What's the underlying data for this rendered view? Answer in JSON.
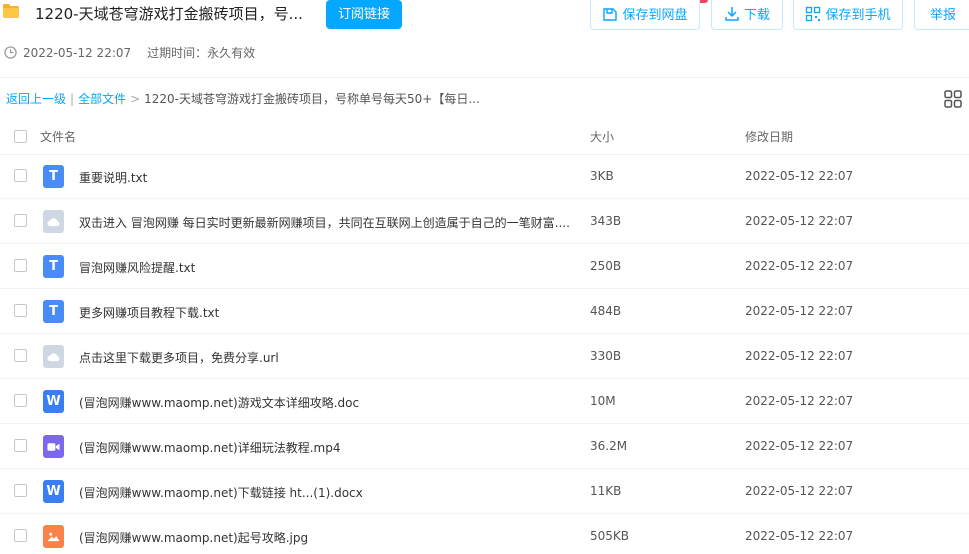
{
  "header": {
    "title": "1220-天域苍穹游戏打金搬砖项目，号...",
    "subscribe_label": "订阅链接",
    "save_disk_label": "保存到网盘",
    "download_label": "下载",
    "save_phone_label": "保存到手机",
    "report_label": "举报",
    "created": "2022-05-12 22:07",
    "expire": "过期时间：永久有效"
  },
  "breadcrumb": {
    "back": "返回上一级",
    "sep": "|",
    "all": "全部文件",
    "arrow": ">",
    "current": "1220-天域苍穹游戏打金搬砖项目，号称单号每天50+【每日..."
  },
  "columns": {
    "name": "文件名",
    "size": "大小",
    "date": "修改日期"
  },
  "files": [
    {
      "name": "重要说明.txt",
      "size": "3KB",
      "date": "2022-05-12 22:07",
      "type": "txt",
      "glyph": "T"
    },
    {
      "name": "双击进入 冒泡网赚 每日实时更新最新网赚项目，共同在互联网上创造属于自己的一笔财富....",
      "size": "343B",
      "date": "2022-05-12 22:07",
      "type": "url",
      "glyph": ""
    },
    {
      "name": "冒泡网赚风险提醒.txt",
      "size": "250B",
      "date": "2022-05-12 22:07",
      "type": "txt",
      "glyph": "T"
    },
    {
      "name": "更多网赚项目教程下载.txt",
      "size": "484B",
      "date": "2022-05-12 22:07",
      "type": "txt",
      "glyph": "T"
    },
    {
      "name": "点击这里下载更多项目，免费分享.url",
      "size": "330B",
      "date": "2022-05-12 22:07",
      "type": "url",
      "glyph": ""
    },
    {
      "name": "(冒泡网赚www.maomp.net)游戏文本详细攻略.doc",
      "size": "10M",
      "date": "2022-05-12 22:07",
      "type": "doc",
      "glyph": "W"
    },
    {
      "name": "(冒泡网赚www.maomp.net)详细玩法教程.mp4",
      "size": "36.2M",
      "date": "2022-05-12 22:07",
      "type": "mp4",
      "glyph": ""
    },
    {
      "name": "(冒泡网赚www.maomp.net)下载链接 ht...(1).docx",
      "size": "11KB",
      "date": "2022-05-12 22:07",
      "type": "doc",
      "glyph": "W"
    },
    {
      "name": "(冒泡网赚www.maomp.net)起号攻略.jpg",
      "size": "505KB",
      "date": "2022-05-12 22:07",
      "type": "jpg",
      "glyph": ""
    }
  ],
  "icons": {
    "folder": "folder-icon",
    "clock": "clock-icon",
    "save": "save-icon",
    "download": "download-icon",
    "phone": "qrcode-icon",
    "grid": "grid-view-icon"
  },
  "colors": {
    "accent": "#06a7ff",
    "folder": "#f5b22d",
    "txt": "#4a8cf7",
    "url": "#cfd8e2",
    "doc": "#3a7ff2",
    "mp4": "#7b68ee",
    "jpg": "#f9824a",
    "badge": "#f5445b"
  }
}
